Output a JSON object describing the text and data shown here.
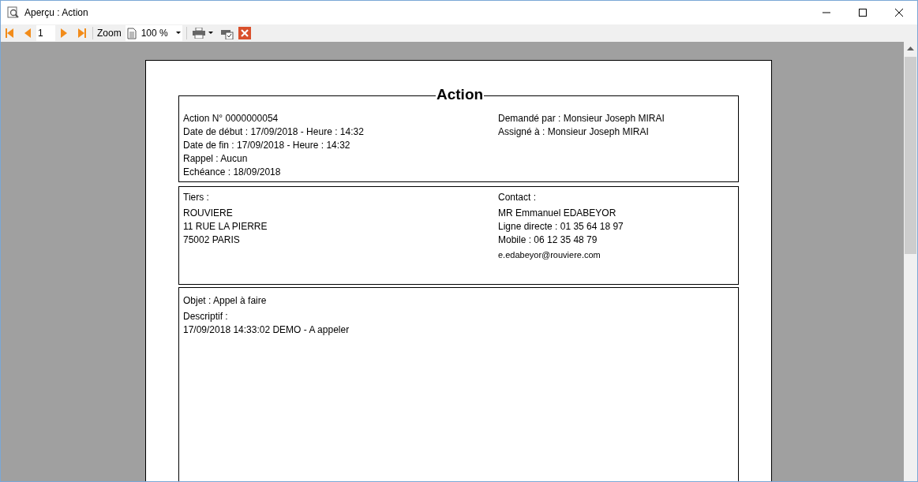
{
  "window": {
    "title": "Aperçu : Action"
  },
  "toolbar": {
    "page": "1",
    "zoom_label": "Zoom",
    "zoom_value": "100 %"
  },
  "document": {
    "title": "Action",
    "header": {
      "left": [
        "Action N° 0000000054",
        "Date de début : 17/09/2018 - Heure : 14:32",
        "Date de fin : 17/09/2018 - Heure : 14:32",
        "Rappel : Aucun",
        "Echéance : 18/09/2018"
      ],
      "right": [
        "Demandé par : Monsieur Joseph MIRAI",
        "Assigné à : Monsieur Joseph MIRAI"
      ]
    },
    "parties": {
      "left_label": "Tiers :",
      "left": [
        "ROUVIERE",
        "11 RUE LA PIERRE",
        "75002 PARIS"
      ],
      "right_label": "Contact :",
      "right": [
        "MR Emmanuel EDABEYOR",
        "Ligne directe : 01 35 64 18 97",
        "Mobile : 06 12 35 48 79",
        "e.edabeyor@rouviere.com"
      ]
    },
    "details": {
      "object": "Objet : Appel à faire",
      "description_label": "Descriptif :",
      "description": "17/09/2018 14:33:02 DEMO - A appeler"
    }
  }
}
